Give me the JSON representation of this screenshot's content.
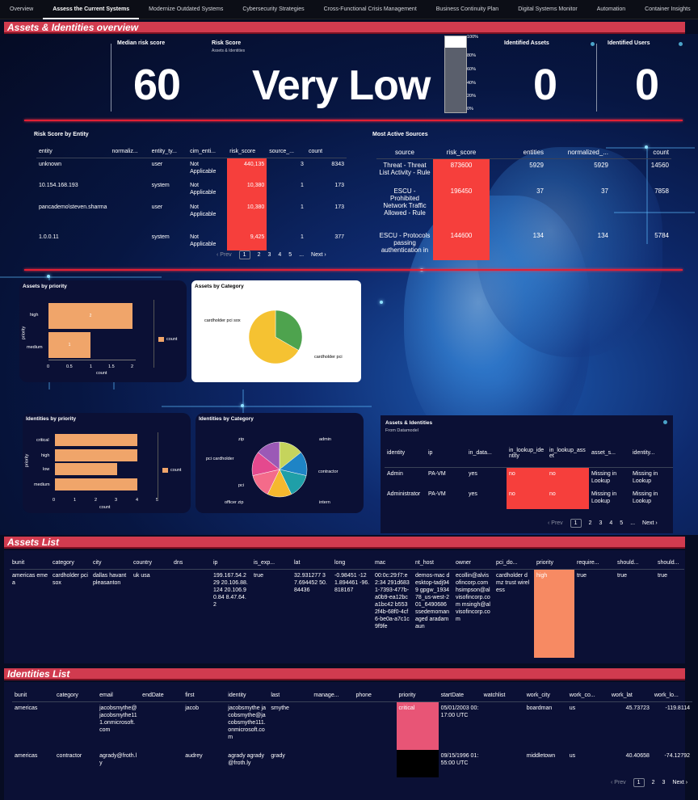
{
  "tabs": [
    "Overview",
    "Assess the Current Systems",
    "Modernize Outdated Systems",
    "Cybersecurity Strategies",
    "Cross-Functional Crisis Management",
    "Business Continuity Plan",
    "Digital Systems Monitor",
    "Automation",
    "Container Insights"
  ],
  "active_tab": "Assess the Current Systems",
  "overview": {
    "banner": "Assets & Identities overview",
    "median_label": "Median risk score",
    "median_value": "60",
    "risk_label": "Risk Score",
    "risk_sub": "Assets & Identities",
    "risk_value": "Very Low",
    "gauge_ticks": [
      "100%",
      "80%",
      "60%",
      "40%",
      "20%",
      "0%"
    ],
    "assets_label": "Identified Assets",
    "assets_value": "0",
    "users_label": "Identified Users",
    "users_value": "0"
  },
  "risk_by_entity": {
    "title": "Risk Score by Entity",
    "columns": [
      "entity",
      "normaliz...",
      "entity_ty...",
      "cim_enti...",
      "risk_score",
      "source_...",
      "count"
    ],
    "rows": [
      [
        "unknown",
        "",
        "user",
        "Not Applicable",
        "440,135",
        "3",
        "8343"
      ],
      [
        "10.154.168.193",
        "",
        "system",
        "Not Applicable",
        "10,380",
        "1",
        "173"
      ],
      [
        "pancademo\\steven.sharma",
        "",
        "user",
        "Not Applicable",
        "10,380",
        "1",
        "173"
      ],
      [
        "1.0.0.11",
        "",
        "system",
        "Not Applicable",
        "9,425",
        "1",
        "377"
      ]
    ],
    "pager": {
      "prev": "‹ Prev",
      "pages": [
        "1",
        "2",
        "3",
        "4",
        "5",
        "..."
      ],
      "next": "Next ›"
    }
  },
  "most_active": {
    "title": "Most Active Sources",
    "columns": [
      "source",
      "risk_score",
      "entities",
      "normalized_...",
      "count"
    ],
    "rows": [
      [
        "Threat - Threat List Activity - Rule",
        "873600",
        "5929",
        "5929",
        "14560"
      ],
      [
        "ESCU - Prohibited Network Traffic Allowed - Rule",
        "196450",
        "37",
        "37",
        "7858"
      ],
      [
        "ESCU - Protocols passing authentication in",
        "144600",
        "134",
        "134",
        "5784"
      ]
    ]
  },
  "assets_by_priority": {
    "title": "Assets by priority",
    "ylabel": "priority",
    "xlabel": "count",
    "legend": "count",
    "xticks": [
      "0",
      "0.5",
      "1",
      "1.5",
      "2"
    ]
  },
  "assets_by_category": {
    "title": "Assets by Category",
    "labels": [
      "cardholder pci sox",
      "cardholder pci"
    ]
  },
  "identities_by_priority": {
    "title": "Identities by priority",
    "ylabel": "priority",
    "xlabel": "count",
    "legend": "count",
    "xticks": [
      "0",
      "1",
      "2",
      "3",
      "4",
      "5"
    ]
  },
  "identities_by_category": {
    "title": "Identities by Category",
    "labels": [
      "zip",
      "admin",
      "pci cardholder",
      "contractor",
      "pci",
      "officer zip",
      "intern"
    ]
  },
  "assets_identities": {
    "title": "Assets & Identities",
    "sub": "From Datamodel",
    "columns": [
      "identity",
      "ip",
      "in_data...",
      "in_lookup_identity",
      "in_lookup_asset",
      "asset_s...",
      "identity..."
    ],
    "rows": [
      [
        "Admin",
        "PA-VM",
        "yes",
        "no",
        "no",
        "Missing in Lookup",
        "Missing in Lookup"
      ],
      [
        "Administrator",
        "PA-VM",
        "yes",
        "no",
        "no",
        "Missing in Lookup",
        "Missing in Lookup"
      ]
    ],
    "pager": {
      "prev": "‹ Prev",
      "pages": [
        "1",
        "2",
        "3",
        "4",
        "5",
        "..."
      ],
      "next": "Next ›"
    }
  },
  "assets_list": {
    "banner": "Assets List",
    "columns": [
      "bunit",
      "category",
      "city",
      "country",
      "dns",
      "ip",
      "is_exp...",
      "lat",
      "long",
      "mac",
      "nt_host",
      "owner",
      "pci_do...",
      "priority",
      "require...",
      "should...",
      "should..."
    ],
    "row": [
      "americas emea",
      "cardholder pci sox",
      "dallas havant pleasanton",
      "uk usa",
      "",
      "199.167.54.229 20.106.88.124 20.106.90.84 8.47.64.2",
      "true",
      "32.931277 37.694452 50.84436",
      "-0.98451 -121.894461 -96.818167",
      "00:0c:29:f7:e2:34 291d6831-7393-477b-a0b9-ea12bca1bc42 b5532f4b-68f0-4cf6-be0a-a7c1c9f9fe",
      "demos-mac desktop-tadj949 gpgw_193478_us-west-201_6490686 ssedemomanaged aradamaun",
      "ecollin@alvisofincorp.com hsimpson@alvisofincorp.com msingh@alvisofincorp.com",
      "cardholder dmz trust wireless",
      "high",
      "true",
      "true",
      "true"
    ]
  },
  "identities_list": {
    "banner": "Identities List",
    "columns": [
      "bunit",
      "category",
      "email",
      "endDate",
      "first",
      "identity",
      "last",
      "manage...",
      "phone",
      "priority",
      "startDate",
      "watchlist",
      "work_city",
      "work_co...",
      "work_lat",
      "work_lo..."
    ],
    "rows": [
      [
        "americas",
        "",
        "jacobsmythe@jacobsmythe111.onmicrosoft.com",
        "",
        "jacob",
        "jacobsmythe jacobsmythe@jacobsmythe111.onmicrosoft.com",
        "smythe",
        "",
        "",
        "critical",
        "05/01/2003 00:17:00 UTC",
        "",
        "boardman",
        "us",
        "45.73723",
        "-119.8114"
      ],
      [
        "americas",
        "contractor",
        "agrady@froth.ly",
        "",
        "audrey",
        "agrady agrady@froth.ly",
        "grady",
        "",
        "",
        "",
        "09/15/1996 01:55:00 UTC",
        "",
        "middletown",
        "us",
        "40.40658",
        "-74.12792"
      ]
    ],
    "pager": {
      "prev": "‹ Prev",
      "pages": [
        "1",
        "2",
        "3"
      ],
      "next": "Next ›"
    }
  },
  "chart_data": [
    {
      "type": "bar",
      "title": "Assets by priority",
      "categories": [
        "high",
        "medium"
      ],
      "values": [
        2,
        1
      ],
      "xlabel": "count",
      "ylabel": "priority",
      "xlim": [
        0,
        2
      ]
    },
    {
      "type": "pie",
      "title": "Assets by Category",
      "categories": [
        "cardholder pci sox",
        "cardholder pci"
      ],
      "values": [
        1,
        2
      ],
      "colors": [
        "#4ea34e",
        "#f5c232"
      ]
    },
    {
      "type": "bar",
      "title": "Identities by priority",
      "categories": [
        "critical",
        "high",
        "low",
        "medium"
      ],
      "values": [
        4,
        4,
        3,
        4
      ],
      "xlabel": "count",
      "ylabel": "priority",
      "xlim": [
        0,
        5
      ]
    },
    {
      "type": "pie",
      "title": "Identities by Category",
      "categories": [
        "admin",
        "contractor",
        "intern",
        "officer zip",
        "pci",
        "pci cardholder",
        "zip"
      ],
      "values": [
        1,
        1,
        1,
        1,
        1,
        1,
        1
      ],
      "colors": [
        "#c5d45c",
        "#1e84c6",
        "#1f9fa8",
        "#f5b82e",
        "#f46b8a",
        "#e4498e",
        "#9b59b6"
      ]
    }
  ]
}
